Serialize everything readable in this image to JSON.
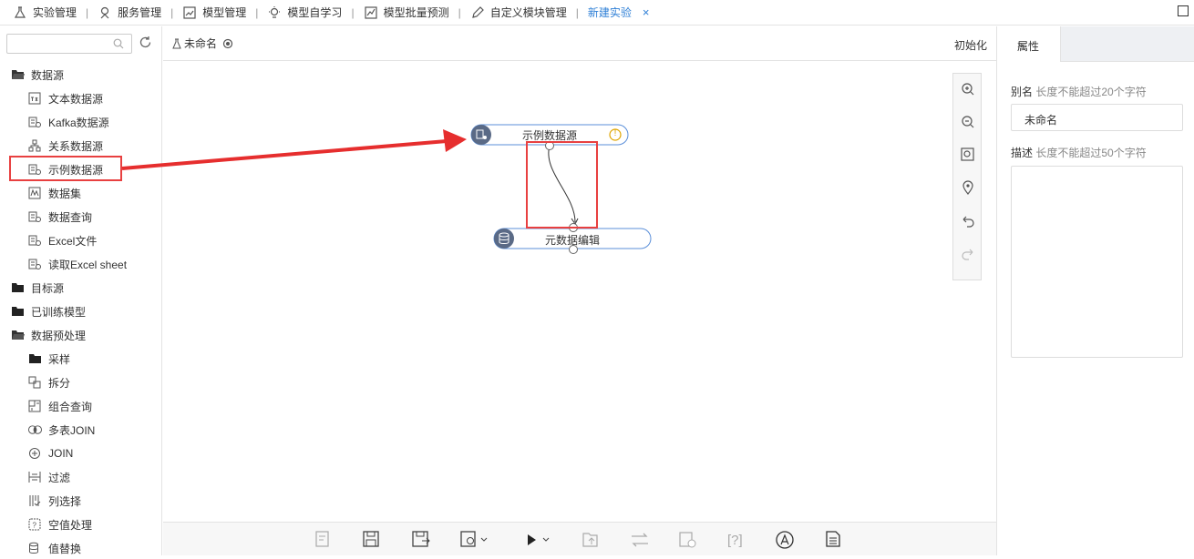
{
  "topbar": {
    "tabs": [
      {
        "label": "实验管理",
        "icon": "flask-icon"
      },
      {
        "label": "服务管理",
        "icon": "service-icon"
      },
      {
        "label": "模型管理",
        "icon": "chart-icon"
      },
      {
        "label": "模型自学习",
        "icon": "bulb-icon"
      },
      {
        "label": "模型批量预测",
        "icon": "trend-icon"
      },
      {
        "label": "自定义模块管理",
        "icon": "edit-icon"
      }
    ],
    "active_tab": "新建实验",
    "close": "×"
  },
  "left": {
    "search_placeholder": "",
    "tree": [
      {
        "type": "cat",
        "label": "数据源",
        "icon": "folder-open-icon"
      },
      {
        "type": "leaf",
        "label": "文本数据源",
        "icon": "txt-file-icon"
      },
      {
        "type": "leaf",
        "label": "Kafka数据源",
        "icon": "db-gear-icon"
      },
      {
        "type": "leaf",
        "label": "关系数据源",
        "icon": "relation-icon"
      },
      {
        "type": "leaf",
        "label": "示例数据源",
        "icon": "db-gear-icon"
      },
      {
        "type": "leaf",
        "label": "数据集",
        "icon": "dataset-icon"
      },
      {
        "type": "leaf",
        "label": "数据查询",
        "icon": "db-gear-icon"
      },
      {
        "type": "leaf",
        "label": "Excel文件",
        "icon": "db-gear-icon"
      },
      {
        "type": "leaf",
        "label": "读取Excel sheet",
        "icon": "db-gear-icon"
      },
      {
        "type": "cat",
        "label": "目标源",
        "icon": "folder-icon"
      },
      {
        "type": "cat",
        "label": "已训练模型",
        "icon": "folder-icon"
      },
      {
        "type": "cat",
        "label": "数据预处理",
        "icon": "folder-open-icon"
      },
      {
        "type": "leaf",
        "label": "采样",
        "icon": "folder-icon"
      },
      {
        "type": "leaf",
        "label": "拆分",
        "icon": "split-icon"
      },
      {
        "type": "leaf",
        "label": "组合查询",
        "icon": "combine-icon"
      },
      {
        "type": "leaf",
        "label": "多表JOIN",
        "icon": "join-icon"
      },
      {
        "type": "leaf",
        "label": "JOIN",
        "icon": "plus-circle-icon"
      },
      {
        "type": "leaf",
        "label": "过滤",
        "icon": "filter-icon"
      },
      {
        "type": "leaf",
        "label": "列选择",
        "icon": "column-icon"
      },
      {
        "type": "leaf",
        "label": "空值处理",
        "icon": "null-icon"
      },
      {
        "type": "leaf",
        "label": "值替换",
        "icon": "replace-icon"
      }
    ]
  },
  "canvas": {
    "experiment_name": "未命名",
    "init_label": "初始化",
    "nodes": [
      {
        "label": "示例数据源",
        "warning": "!"
      },
      {
        "label": "元数据编辑"
      }
    ]
  },
  "right": {
    "tab": "属性",
    "alias_label": "别名",
    "alias_hint": "长度不能超过20个字符",
    "alias_value": "未命名",
    "desc_label": "描述",
    "desc_hint": "长度不能超过50个字符"
  },
  "colors": {
    "accent": "#2e7fd6",
    "highlight": "#e84040",
    "node_border": "#5b8fd9"
  }
}
